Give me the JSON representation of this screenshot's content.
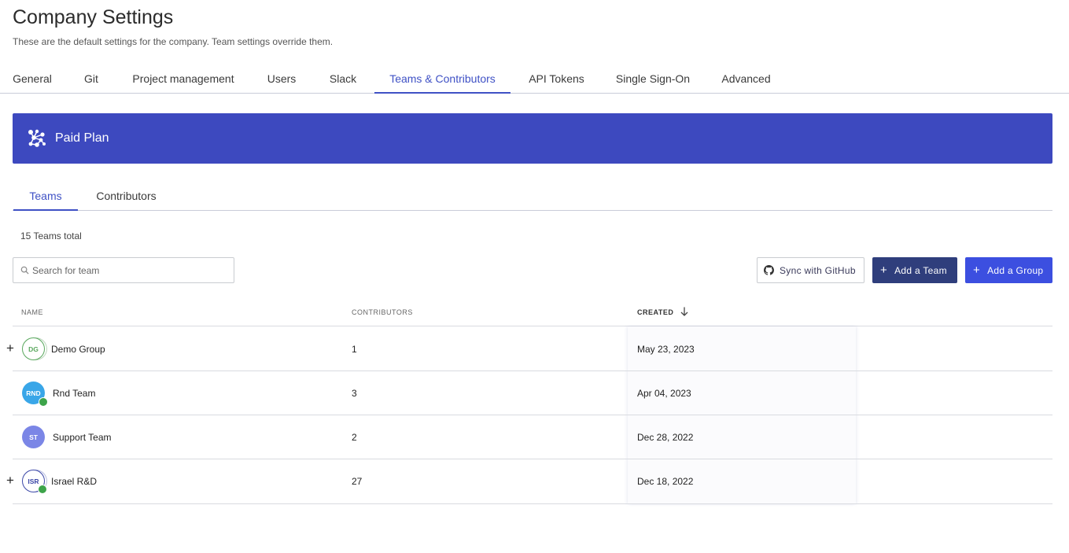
{
  "header": {
    "title": "Company Settings",
    "subtitle": "These are the default settings for the company. Team settings override them."
  },
  "top_tabs": [
    {
      "label": "General",
      "active": false
    },
    {
      "label": "Git",
      "active": false
    },
    {
      "label": "Project management",
      "active": false
    },
    {
      "label": "Users",
      "active": false
    },
    {
      "label": "Slack",
      "active": false
    },
    {
      "label": "Teams & Contributors",
      "active": true
    },
    {
      "label": "API Tokens",
      "active": false
    },
    {
      "label": "Single Sign-On",
      "active": false
    },
    {
      "label": "Advanced",
      "active": false
    }
  ],
  "plan": {
    "name": "Paid Plan",
    "icon": "network-nodes-icon",
    "color": "#3d49bf"
  },
  "sub_tabs": [
    {
      "label": "Teams",
      "active": true
    },
    {
      "label": "Contributors",
      "active": false
    }
  ],
  "teams_total": "15 Teams total",
  "search": {
    "placeholder": "Search for team",
    "value": ""
  },
  "actions": {
    "sync_label": "Sync with GitHub",
    "add_team_label": "Add a Team",
    "add_group_label": "Add a Group"
  },
  "colors": {
    "accent": "#3f51c5",
    "add_team_bg": "#2f3e7c",
    "add_group_bg": "#3c4fe0"
  },
  "table": {
    "columns": {
      "name": "NAME",
      "contributors": "CONTRIBUTORS",
      "created": "CREATED"
    },
    "sort": {
      "column": "created",
      "direction": "desc"
    },
    "rows": [
      {
        "initials": "DG",
        "name": "Demo Group",
        "contributors": "1",
        "created": "May 23, 2023",
        "expandable": true,
        "github": false
      },
      {
        "initials": "RND",
        "name": "Rnd Team",
        "contributors": "3",
        "created": "Apr 04, 2023",
        "expandable": false,
        "github": true
      },
      {
        "initials": "ST",
        "name": "Support Team",
        "contributors": "2",
        "created": "Dec 28, 2022",
        "expandable": false,
        "github": false
      },
      {
        "initials": "ISR",
        "name": "Israel R&D",
        "contributors": "27",
        "created": "Dec 18, 2022",
        "expandable": true,
        "github": true
      }
    ]
  }
}
